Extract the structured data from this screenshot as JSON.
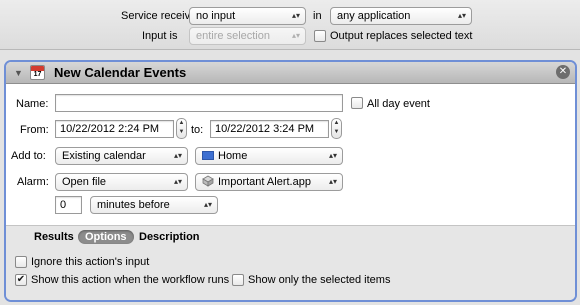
{
  "header": {
    "service_receives_label": "Service receives",
    "service_receives_value": "no input",
    "in_label": "in",
    "application_value": "any application",
    "input_is_label": "Input is",
    "input_is_value": "entire selection",
    "output_replaces_label": "Output replaces selected text",
    "output_replaces_checked": false
  },
  "action": {
    "title": "New Calendar Events",
    "icon_day": "17",
    "close_glyph": "✕",
    "disclosure_glyph": "▼",
    "name_label": "Name:",
    "name_value": "",
    "all_day_label": "All day event",
    "all_day_checked": false,
    "from_label": "From:",
    "from_value": "10/22/2012   2:24 PM",
    "to_label": "to:",
    "to_value": "10/22/2012   3:24 PM",
    "add_to_label": "Add to:",
    "add_to_value": "Existing calendar",
    "calendar_value": "Home",
    "calendar_color": "#3d6fd1",
    "alarm_label": "Alarm:",
    "alarm_value": "Open file",
    "alarm_file_value": "Important Alert.app",
    "alarm_file_icon": "application-icon",
    "minutes_value": "0",
    "minutes_unit_value": "minutes before"
  },
  "options": {
    "tabs": [
      {
        "label": "Results",
        "selected": false
      },
      {
        "label": "Options",
        "selected": true
      },
      {
        "label": "Description",
        "selected": false
      }
    ],
    "ignore_input_label": "Ignore this action's input",
    "ignore_input_checked": false,
    "show_when_runs_label": "Show this action when the workflow runs",
    "show_when_runs_checked": true,
    "show_selected_only_label": "Show only the selected items",
    "show_selected_only_checked": false,
    "check_glyph": "✔"
  },
  "glyphs": {
    "popup_arrows": "▴▾",
    "stepper_up": "▲",
    "stepper_down": "▼"
  },
  "colors": {
    "panel_border": "#6f8fd6",
    "header_bg": "#e3e3e3",
    "options_bg": "#e6e6e6"
  }
}
